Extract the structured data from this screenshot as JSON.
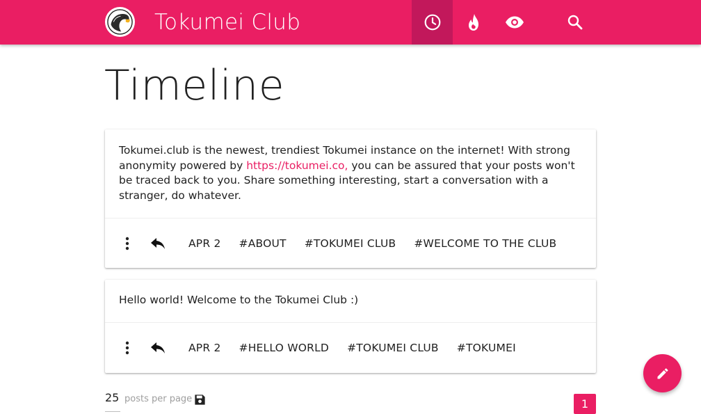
{
  "header": {
    "brand": "Tokumei Club",
    "nav": [
      {
        "name": "timeline",
        "icon": "clock-icon",
        "active": true
      },
      {
        "name": "trending",
        "icon": "fire-icon",
        "active": false
      },
      {
        "name": "watch",
        "icon": "eye-icon",
        "active": false
      },
      {
        "name": "search",
        "icon": "search-icon",
        "active": false
      }
    ],
    "accent_color": "#ea1e63",
    "active_color": "#c2185b"
  },
  "page": {
    "title": "Timeline"
  },
  "posts": [
    {
      "text_before_link": "Tokumei.club is the newest, trendiest Tokumei instance on the internet! With strong anonymity powered by ",
      "link_text": "https://tokumei.co,",
      "text_after_link": " you can be assured that your posts won't be traced back to you. Share something interesting, start a conversation with a stranger, do whatever.",
      "date": "APR 2",
      "tags": [
        "#ABOUT",
        "#TOKUMEI CLUB",
        "#WELCOME TO THE CLUB"
      ]
    },
    {
      "text": "Hello world! Welcome to the Tokumei Club :)",
      "date": "APR 2",
      "tags": [
        "#HELLO WORLD",
        "#TOKUMEI CLUB",
        "#TOKUMEI"
      ]
    }
  ],
  "footer": {
    "per_page_value": "25",
    "per_page_label": "posts per page",
    "current_page": "1"
  }
}
